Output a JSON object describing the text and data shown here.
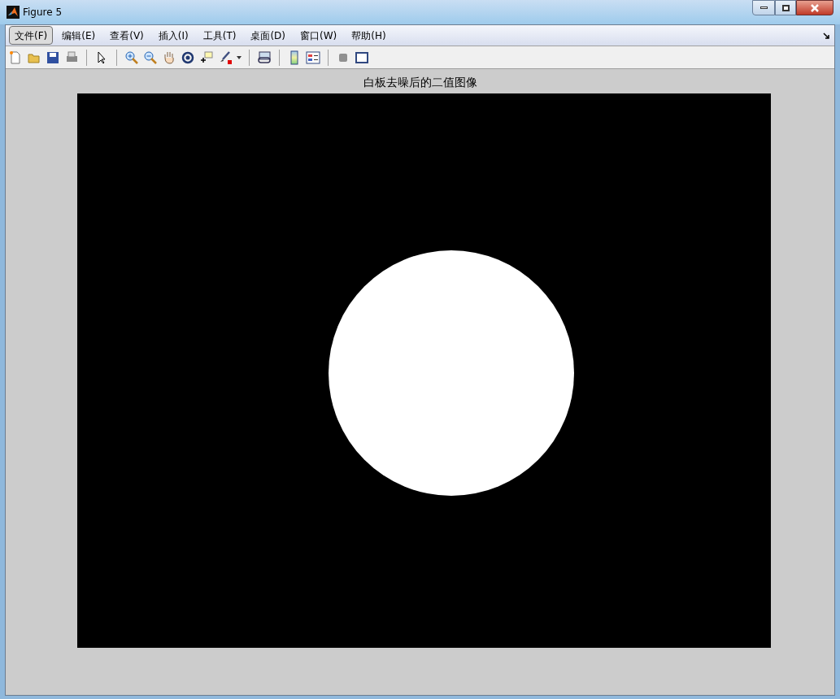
{
  "window": {
    "title": "Figure 5"
  },
  "menu": [
    {
      "label": "文件(F)",
      "selected": true
    },
    {
      "label": "编辑(E)",
      "selected": false
    },
    {
      "label": "查看(V)",
      "selected": false
    },
    {
      "label": "插入(I)",
      "selected": false
    },
    {
      "label": "工具(T)",
      "selected": false
    },
    {
      "label": "桌面(D)",
      "selected": false
    },
    {
      "label": "窗口(W)",
      "selected": false
    },
    {
      "label": "帮助(H)",
      "selected": false
    }
  ],
  "axes": {
    "title": "白板去噪后的二值图像"
  }
}
